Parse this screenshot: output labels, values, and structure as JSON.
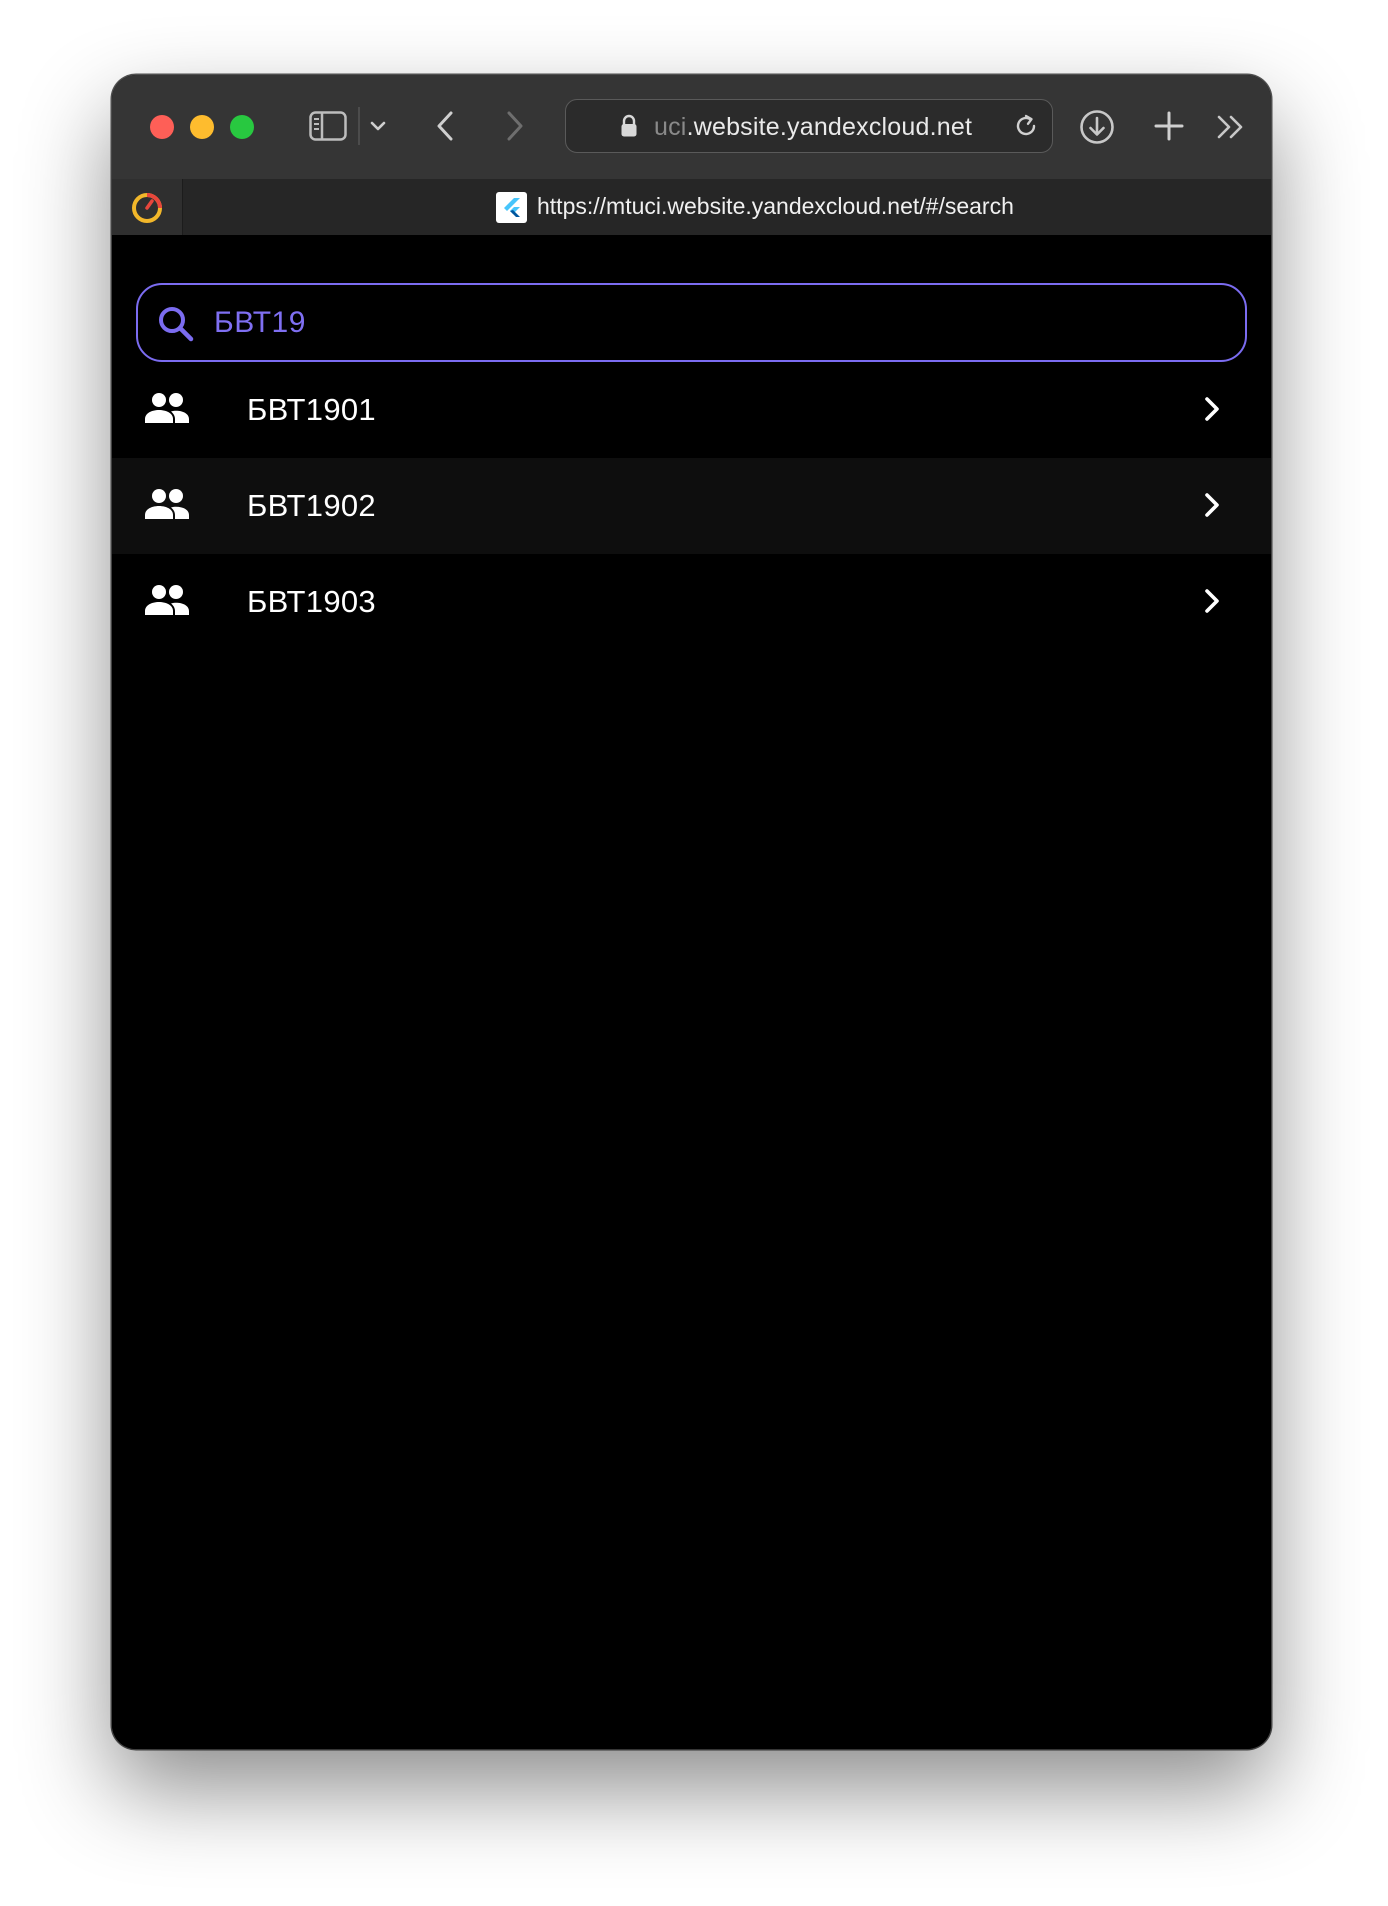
{
  "browser": {
    "address_faded": "uci",
    "address_domain": ".website.yandexcloud.net",
    "tab_title": "https://mtuci.website.yandexcloud.net/#/search",
    "icons": {
      "sidebar": "sidebar-icon",
      "dropdown": "chevron-down-icon",
      "back": "back-icon",
      "forward": "forward-icon",
      "lock": "lock-icon",
      "reload": "reload-icon",
      "download": "download-icon",
      "new_tab": "plus-icon",
      "more": "double-chevron-icon"
    }
  },
  "search": {
    "value": "БВТ19",
    "accent_color": "#7b6cf0"
  },
  "results": [
    {
      "label": "БВТ1901",
      "icon": "group-icon"
    },
    {
      "label": "БВТ1902",
      "icon": "group-icon"
    },
    {
      "label": "БВТ1903",
      "icon": "group-icon"
    }
  ]
}
